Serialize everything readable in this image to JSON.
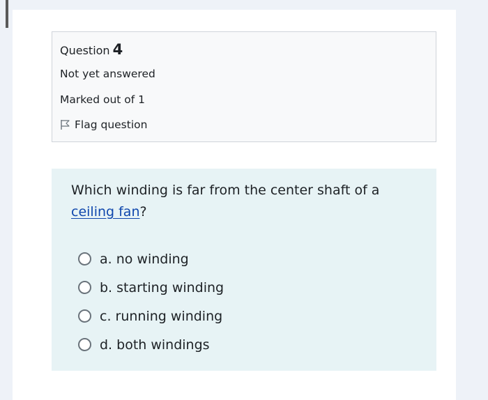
{
  "question": {
    "label": "Question",
    "number": "4",
    "status": "Not yet answered",
    "marks": "Marked out of 1",
    "flag_label": "Flag question"
  },
  "content": {
    "text_before": "Which winding is far from the center shaft of a ",
    "link_text": "ceiling fan",
    "text_after": "?",
    "options": [
      {
        "label": "a. no winding",
        "selected": false
      },
      {
        "label": "b. starting winding",
        "selected": false
      },
      {
        "label": "c. running winding",
        "selected": false
      },
      {
        "label": "d. both windings",
        "selected": false
      }
    ]
  },
  "colors": {
    "info_background": "#f8f9fa",
    "content_background": "#e7f3f5",
    "link": "#0f47ad"
  },
  "icons": {
    "flag": "flag-icon"
  }
}
